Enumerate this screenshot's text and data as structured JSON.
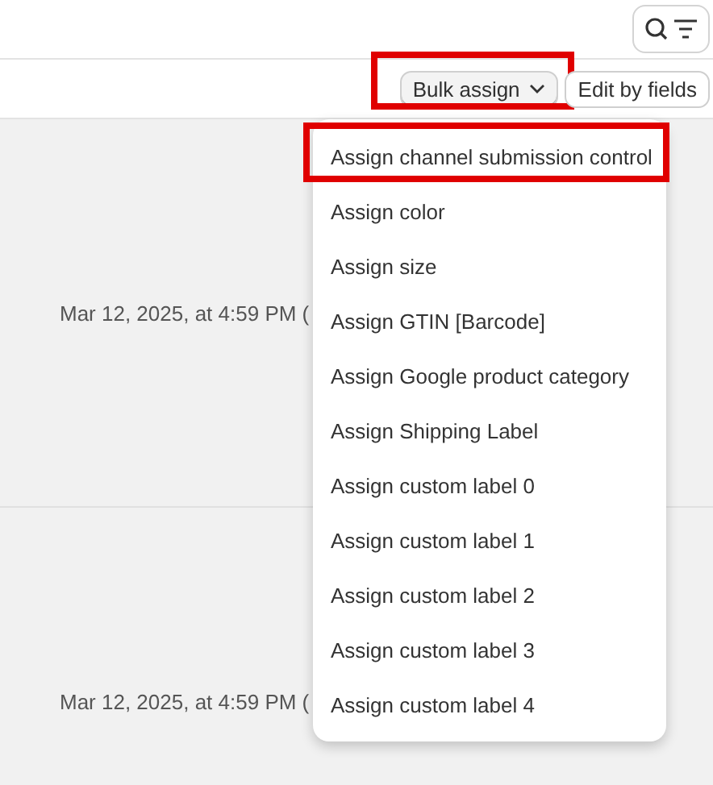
{
  "toolbar": {
    "buttons": [
      {
        "label": "Bulk assign",
        "kind": "dropdown",
        "highlighted": true
      },
      {
        "label": "Edit by fields",
        "kind": "plain",
        "highlighted": false
      }
    ]
  },
  "rows": [
    {
      "date": "Mar 12, 2025, at 4:59 PM ("
    },
    {
      "date": "Mar 12, 2025, at 4:59 PM ("
    }
  ],
  "menu": {
    "items": [
      {
        "label": "Assign channel submission control",
        "highlighted": true
      },
      {
        "label": "Assign color",
        "highlighted": false
      },
      {
        "label": "Assign size",
        "highlighted": false
      },
      {
        "label": "Assign GTIN [Barcode]",
        "highlighted": false
      },
      {
        "label": "Assign Google product category",
        "highlighted": false
      },
      {
        "label": "Assign Shipping Label",
        "highlighted": false
      },
      {
        "label": "Assign custom label 0",
        "highlighted": false
      },
      {
        "label": "Assign custom label 1",
        "highlighted": false
      },
      {
        "label": "Assign custom label 2",
        "highlighted": false
      },
      {
        "label": "Assign custom label 3",
        "highlighted": false
      },
      {
        "label": "Assign custom label 4",
        "highlighted": false
      }
    ]
  }
}
